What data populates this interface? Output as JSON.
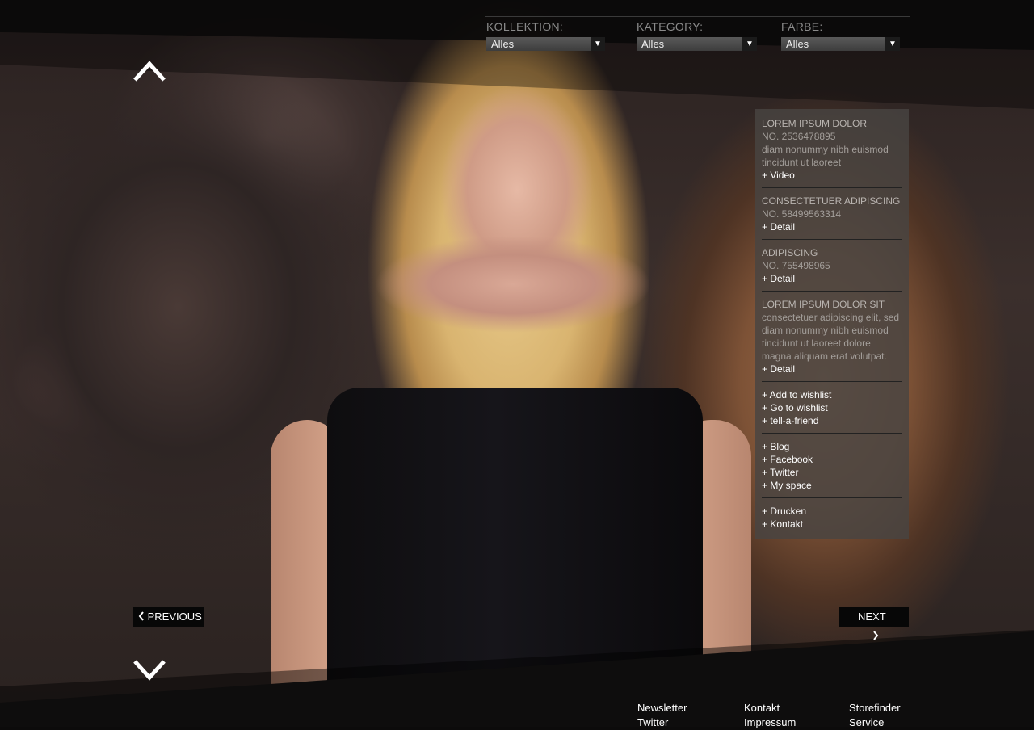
{
  "filters": [
    {
      "label": "KOLLEKTION:",
      "value": "Alles"
    },
    {
      "label": "KATEGORY:",
      "value": "Alles"
    },
    {
      "label": "FARBE:",
      "value": "Alles"
    }
  ],
  "nav": {
    "previous": "PREVIOUS",
    "next": "NEXT"
  },
  "panel": {
    "items": [
      {
        "title": "LOREM IPSUM DOLOR",
        "number": "NO. 2536478895",
        "desc": "diam nonummy nibh euismod tincidunt ut laoreet",
        "link": "+ Video"
      },
      {
        "title": "CONSECTETUER ADIPISCING",
        "number": "NO. 58499563314",
        "link": "+ Detail"
      },
      {
        "title": "ADIPISCING",
        "number": "NO. 755498965",
        "link": "+ Detail"
      },
      {
        "title": "LOREM IPSUM DOLOR SIT",
        "desc": "consectetuer adipiscing elit, sed diam nonummy nibh euismod tincidunt ut laoreet dolore magna aliquam erat volutpat.",
        "link": "+ Detail"
      }
    ],
    "wishlist": [
      "+ Add to wishlist",
      "+ Go to wishlist",
      "+ tell-a-friend"
    ],
    "social": [
      "+ Blog",
      "+ Facebook",
      "+ Twitter",
      "+ My space"
    ],
    "misc": [
      "+ Drucken",
      "+ Kontakt"
    ]
  },
  "footer": {
    "col1": [
      "Newsletter",
      "Twitter"
    ],
    "col2": [
      "Kontakt",
      "Impressum"
    ],
    "col3": [
      "Storefinder",
      "Service"
    ]
  },
  "icons": {
    "up": "chevron-up-icon",
    "down": "chevron-down-icon",
    "prev": "chevron-left-icon",
    "next": "chevron-right-icon",
    "select": "chevron-down-icon"
  },
  "colors": {
    "panel_bg": "#48443f",
    "band": "#0e0d0d",
    "select_bg": "#4a4a4a"
  }
}
